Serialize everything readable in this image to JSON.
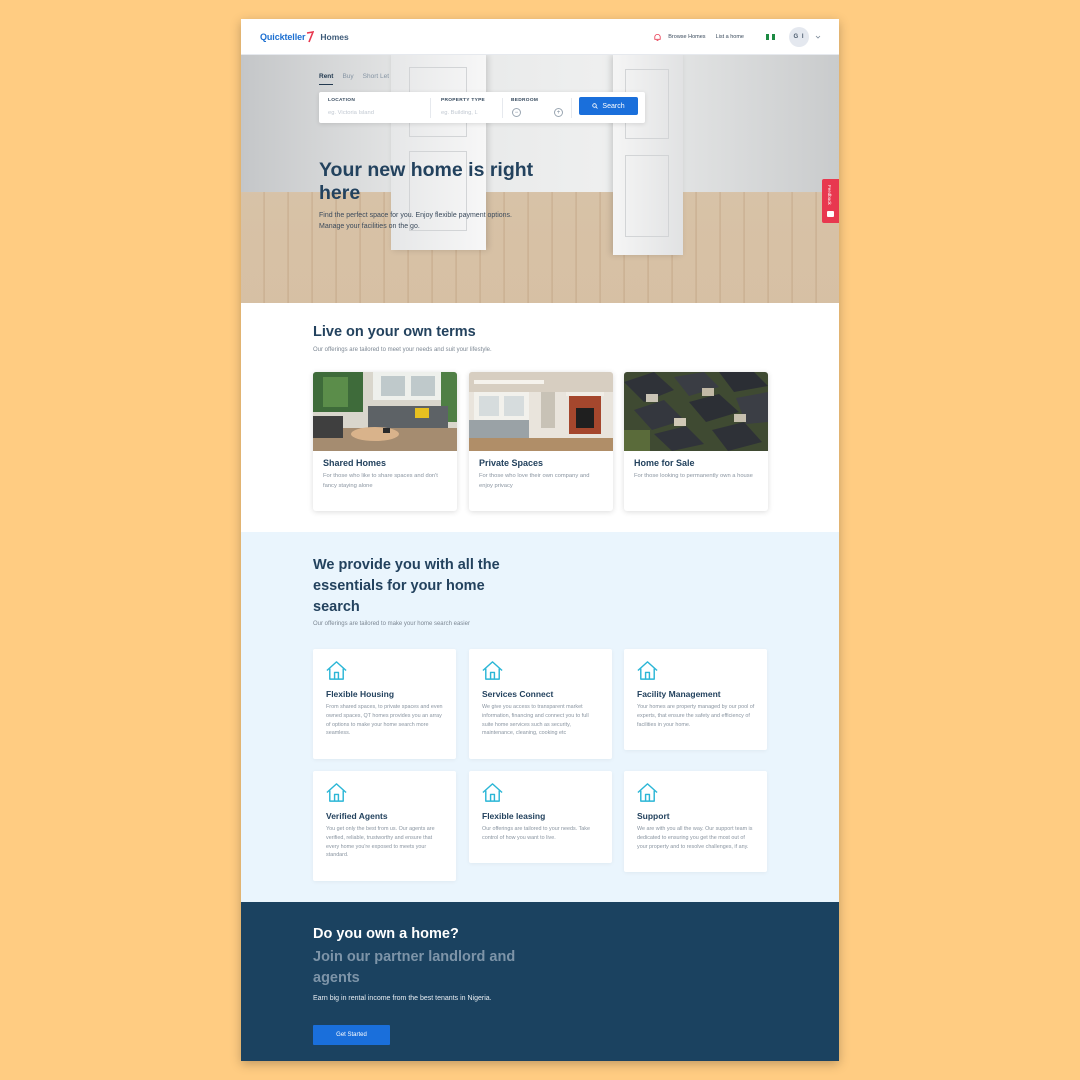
{
  "header": {
    "logo_brand": "Quickteller",
    "logo_product": "Homes",
    "nav": {
      "browse": "Browse Homes",
      "list": "List a home"
    },
    "avatar_initials": "G I",
    "icons": [
      "bell-icon",
      "nigeria-flag-icon",
      "chevron-down-icon"
    ]
  },
  "hero": {
    "tabs": [
      "Rent",
      "Buy",
      "Short Let"
    ],
    "active_tab": "Rent",
    "search": {
      "location_label": "LOCATION",
      "location_placeholder": "eg. Victoria Island",
      "property_label": "PROPERTY TYPE",
      "property_placeholder": "eg. Building, L",
      "bedroom_label": "BEDROOM",
      "minus": "−",
      "plus": "+",
      "button": "Search"
    },
    "title": "Your new home is right here",
    "subtitle": "Find the perfect space for you. Enjoy flexible payment options. Manage your facilities on the go.",
    "feedback": "Feedback"
  },
  "offerings": {
    "title": "Live on your own terms",
    "subtitle": "Our offerings are tailored to meet your needs and suit your lifestyle.",
    "cards": [
      {
        "title": "Shared Homes",
        "desc": "For those who like to share spaces and don't fancy staying alone"
      },
      {
        "title": "Private Spaces",
        "desc": "For those who love their own company and enjoy privacy"
      },
      {
        "title": "Home for Sale",
        "desc": "For those looking to permanently own a house"
      }
    ]
  },
  "essentials": {
    "title": "We provide you with all the essentials for your home search",
    "subtitle": "Our offerings are tailored to make your home search easier",
    "features": [
      {
        "title": "Flexible Housing",
        "desc": "From shared spaces, to private spaces and even owned spaces, QT homes provides you an array of options to make your home search more seamless."
      },
      {
        "title": "Services Connect",
        "desc": "We give you access to transparent market information, financing and connect you to full suite home services such as security, maintenance, cleaning, cooking etc"
      },
      {
        "title": "Facility Management",
        "desc": "Your homes are property managed by our pool of experts, that ensure the safety and efficiency of facilities in your home."
      },
      {
        "title": "Verified Agents",
        "desc": "You get only the best from us. Our agents are verified, reliable, trustworthy and ensure that every home you're exposed to meets your standard."
      },
      {
        "title": "Flexible leasing",
        "desc": "Our offerings are tailored to your needs. Take control of how you want to live."
      },
      {
        "title": "Support",
        "desc": "We are with you all the way. Our support team is dedicated to ensuring you get the most out of your property and to resolve challenges, if any."
      }
    ]
  },
  "owner_cta": {
    "title": "Do you own a home?",
    "subtitle": "Join our partner landlord and agents",
    "text": "Earn big in rental income from the best tenants in Nigeria.",
    "button": "Get Started"
  },
  "colors": {
    "page_background": "#FFCC82",
    "primary_blue": "#1a6fdb",
    "navy": "#1b4260",
    "heading": "#23425e",
    "feature_icon": "#2bb6d6",
    "feedback_red": "#e8384f",
    "essentials_bg": "#eaf5fd"
  }
}
